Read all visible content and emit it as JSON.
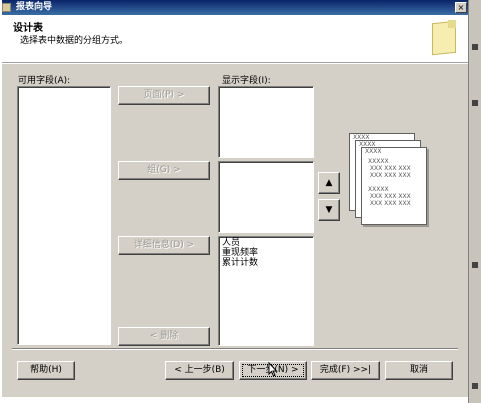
{
  "window": {
    "title": "报表向导",
    "close_glyph": "×"
  },
  "header": {
    "heading": "设计表",
    "subheading": "选择表中数据的分组方式。"
  },
  "available_fields": {
    "label": "可用字段(A):",
    "items": []
  },
  "displayed_fields": {
    "label": "显示字段(I):"
  },
  "move_buttons": {
    "page": "页面(P) >",
    "group": "组(G) >",
    "details": "详细信息(D) >",
    "remove": "< 删除"
  },
  "page_list": {
    "items": []
  },
  "group_list": {
    "items": []
  },
  "details_list": {
    "items": [
      "人员",
      "重现频率",
      "累计计数"
    ]
  },
  "order_buttons": {
    "up_glyph": "▲",
    "down_glyph": "▼"
  },
  "preview": {
    "card1": "XXXX",
    "card2": "XXXX",
    "card3": "XXXX",
    "rows": "XXXXX\n XXX XXX XXX\n XXX XXX XXX\n\nXXXXX\n XXX XXX XXX\n XXX XXX XXX"
  },
  "footer": {
    "help": "帮助(H)",
    "back": "< 上一步(B)",
    "next": "下一步(N) >",
    "finish": "完成(F) >>|",
    "cancel": "取消"
  }
}
